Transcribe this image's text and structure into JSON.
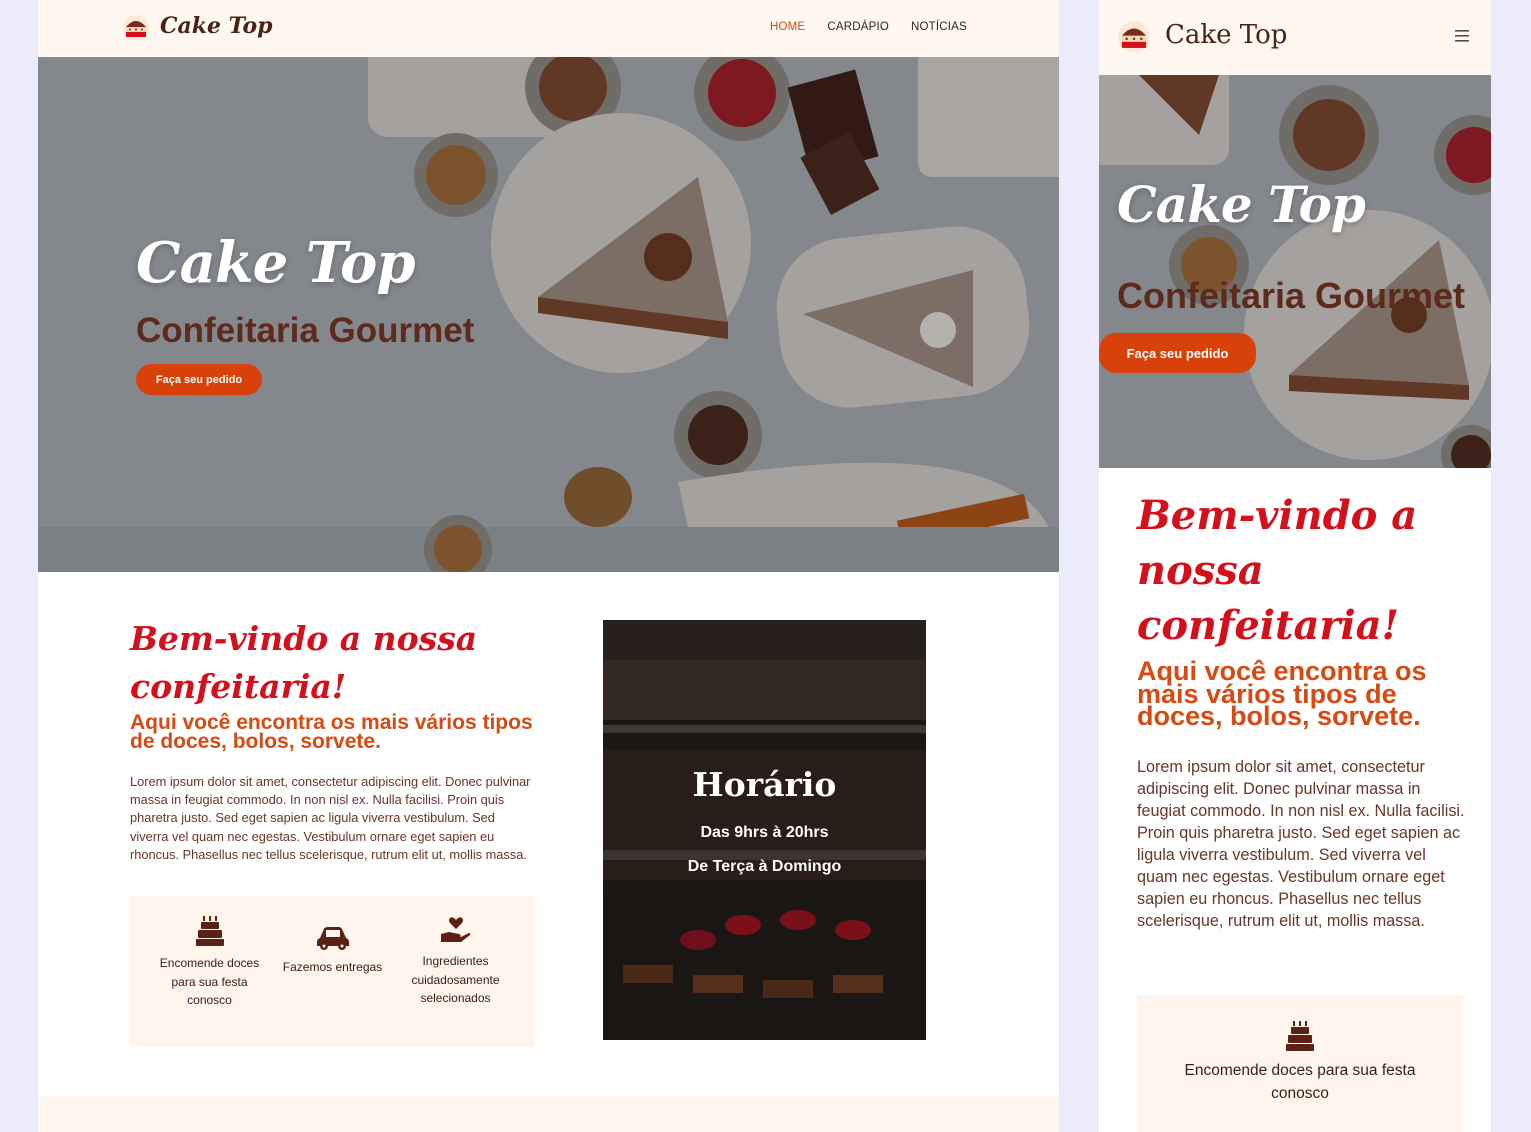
{
  "brand": {
    "name": "Cake Top"
  },
  "nav": {
    "home": "HOME",
    "cardapio": "CARDÁPIO",
    "noticias": "NOTÍCIAS"
  },
  "hero": {
    "title": "Cake Top",
    "subtitle": "Confeitaria Gourmet",
    "cta": "Faça seu pedido"
  },
  "welcome": {
    "title": "Bem-vindo a nossa confeitaria!",
    "subtitle": "Aqui você encontra os mais vários tipos de doces, bolos, sorvete.",
    "body": "Lorem ipsum dolor sit amet, consectetur adipiscing elit. Donec pulvinar massa in feugiat commodo. In non nisl ex. Nulla facilisi. Proin quis pharetra justo. Sed eget sapien ac ligula viverra vestibulum. Sed viverra vel quam nec egestas. Vestibulum ornare eget sapien eu rhoncus. Phasellus nec tellus scelerisque, rutrum elit ut, mollis massa."
  },
  "features": [
    {
      "label": "Encomende doces para sua festa conosco",
      "icon": "birthday-cake-icon"
    },
    {
      "label": "Fazemos entregas",
      "icon": "car-icon"
    },
    {
      "label": "Ingredientes cuidadosamente selecionados",
      "icon": "hand-heart-icon"
    }
  ],
  "hours": {
    "title": "Horário",
    "time": "Das 9hrs à 20hrs",
    "days": "De Terça à Domingo"
  },
  "colors": {
    "accent": "#d9410a",
    "title_red": "#d4101c",
    "brown": "#4a2216",
    "cream": "#fff8f1"
  }
}
